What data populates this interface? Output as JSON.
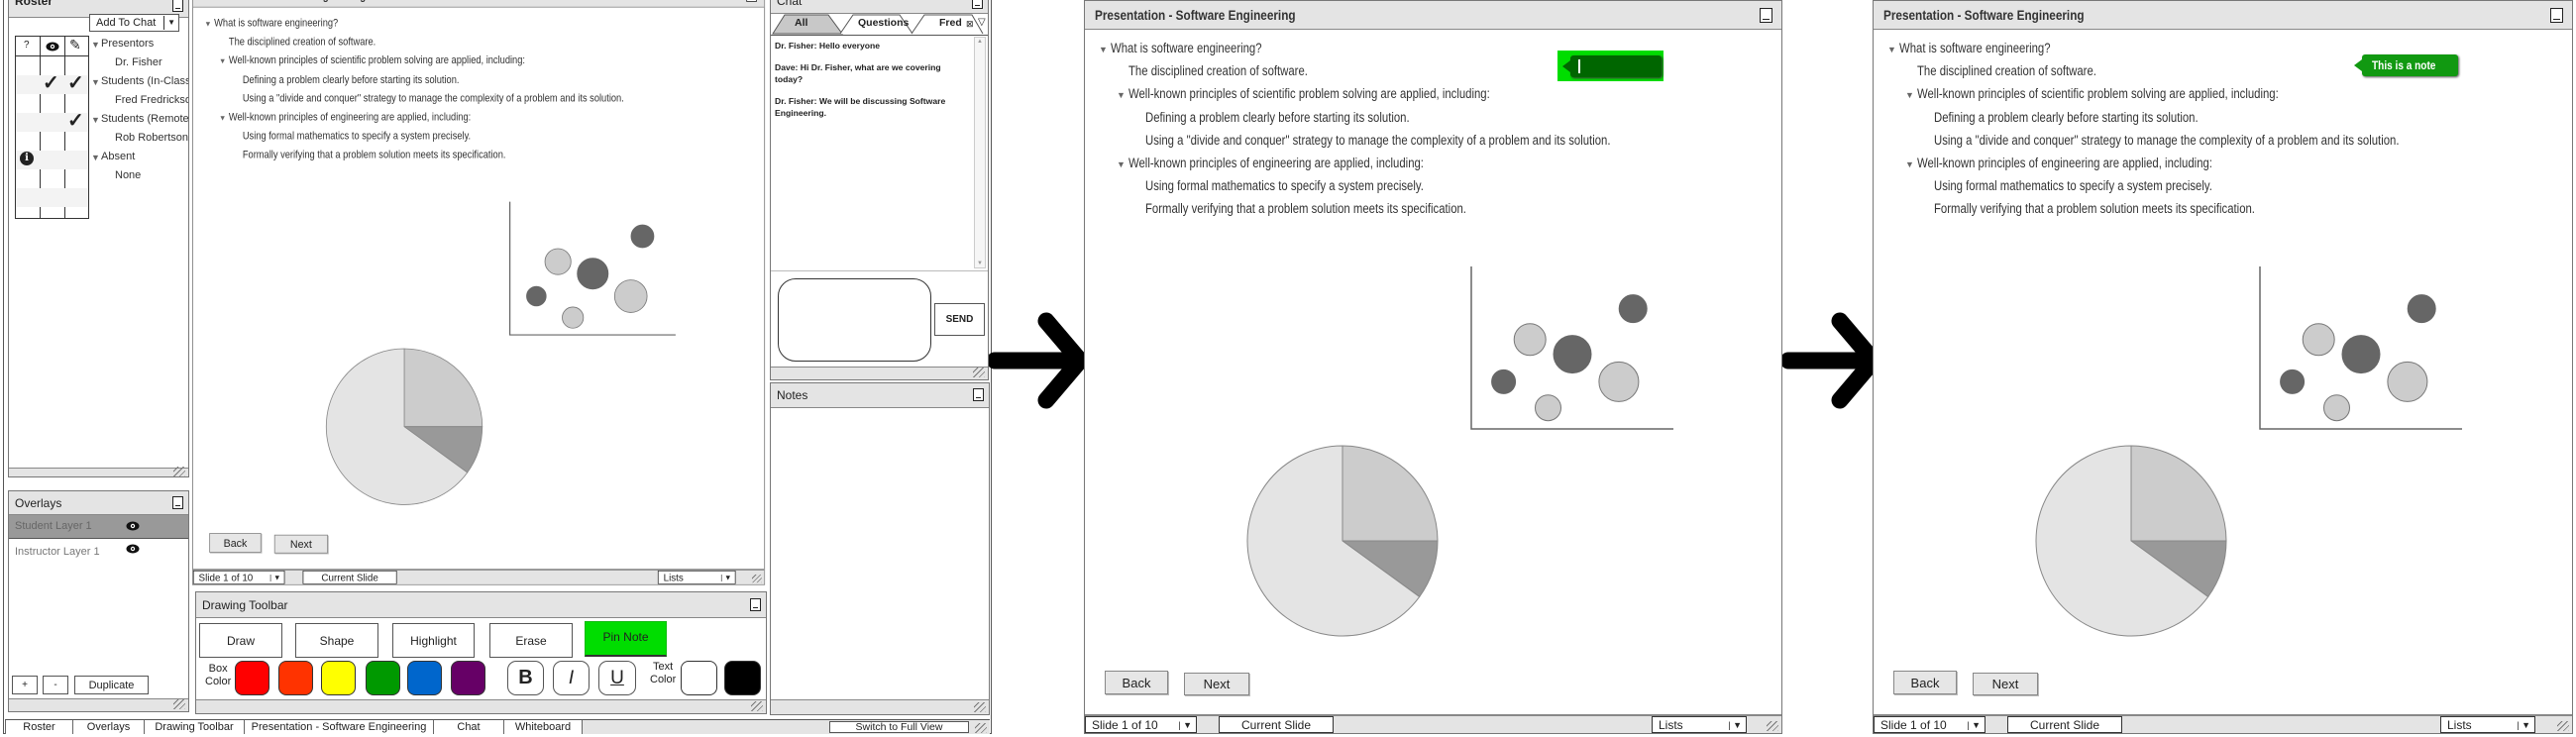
{
  "roster": {
    "title": "Roster",
    "add_to_chat": "Add To Chat",
    "columns": [
      "?",
      "eye-icon",
      "pencil-icon"
    ],
    "groups": [
      {
        "label": "Presentors",
        "members": [
          "Dr. Fisher"
        ]
      },
      {
        "label": "Students (In-Class)",
        "members": [
          "Fred Fredrickson"
        ]
      },
      {
        "label": "Students (Remote)",
        "members": [
          "Rob Robertson"
        ]
      },
      {
        "label": "Absent",
        "members": [
          "None"
        ]
      }
    ],
    "status": {
      "Dr. Fisher": [
        "view",
        "edit"
      ],
      "Fred Fredrickson": [
        "edit"
      ],
      "Rob Robertson": [
        "question"
      ]
    }
  },
  "overlays": {
    "title": "Overlays",
    "layers": [
      {
        "label": "Student Layer 1",
        "selected": true,
        "visible": true
      },
      {
        "label": "Instructor Layer 1",
        "selected": false,
        "visible": true
      }
    ],
    "add": "+",
    "remove": "-",
    "duplicate": "Duplicate"
  },
  "slide": {
    "title": "Presentation - Software Engineering",
    "outline": [
      {
        "text": "What is software engineering?",
        "level": 0,
        "toggle": true
      },
      {
        "text": "The disciplined creation of software.",
        "level": 1,
        "toggle": false
      },
      {
        "text": "Well-known principles of scientific problem solving are applied, including:",
        "level": 1,
        "toggle": true
      },
      {
        "text": "Defining a problem clearly before starting its solution.",
        "level": 2,
        "toggle": false
      },
      {
        "text": "Using a \"divide and conquer\" strategy to manage the complexity of a problem and its solution.",
        "level": 2,
        "toggle": false
      },
      {
        "text": "Well-known principles of engineering are applied, including:",
        "level": 1,
        "toggle": true
      },
      {
        "text": "Using formal mathematics to specify a system precisely.",
        "level": 2,
        "toggle": false
      },
      {
        "text": "Formally verifying that a problem solution meets its specification.",
        "level": 2,
        "toggle": false
      }
    ],
    "back": "Back",
    "next": "Next",
    "slide_select": "Slide 1 of 10",
    "current_slide": "Current Slide",
    "lists_select": "Lists",
    "pie": {
      "values": [
        25,
        10,
        65
      ],
      "colors": [
        "#cccccc",
        "#999999",
        "#e4e4e4"
      ]
    },
    "scatter": {
      "points": [
        {
          "x": 80,
          "y": 74,
          "size": 14,
          "shade": "#666666"
        },
        {
          "x": 29,
          "y": 55,
          "size": 16,
          "shade": "#cccccc"
        },
        {
          "x": 50,
          "y": 46,
          "size": 19,
          "shade": "#666666"
        },
        {
          "x": 16,
          "y": 29,
          "size": 12,
          "shade": "#666666"
        },
        {
          "x": 73,
          "y": 29,
          "size": 20,
          "shade": "#cccccc"
        },
        {
          "x": 38,
          "y": 13,
          "size": 13,
          "shade": "#cccccc"
        }
      ]
    },
    "note_text": "This is a note"
  },
  "drawing_toolbar": {
    "title": "Drawing Toolbar",
    "tools": [
      "Draw",
      "Shape",
      "Highlight",
      "Erase",
      "Pin Note"
    ],
    "active_tool": "Pin Note",
    "box_color_label": [
      "Box",
      "Color"
    ],
    "box_colors": [
      "#ff0000",
      "#ff3300",
      "#ffff00",
      "#009900",
      "#0066cc",
      "#660066"
    ],
    "bold": "B",
    "italic": "I",
    "underline": "U",
    "text_color_label": [
      "Text",
      "Color"
    ],
    "text_colors": [
      "#ffffff",
      "#000000"
    ],
    "accent": "#00dd00"
  },
  "chat": {
    "title": "Chat",
    "tabs": [
      "All",
      "Questions",
      "Fred"
    ],
    "messages": [
      "Dr. Fisher: Hello everyone",
      "Dave: Hi Dr. Fisher, what are we covering today?",
      "Dr. Fisher: We will be discussing Software Engineering."
    ],
    "input_value": "",
    "send": "SEND"
  },
  "notes": {
    "title": "Notes"
  },
  "taskbar": {
    "tabs": [
      "Roster",
      "Overlays",
      "Drawing Toolbar",
      "Presentation - Software Engineering",
      "Chat",
      "Whiteboard"
    ],
    "switch": "Switch to Full View"
  }
}
